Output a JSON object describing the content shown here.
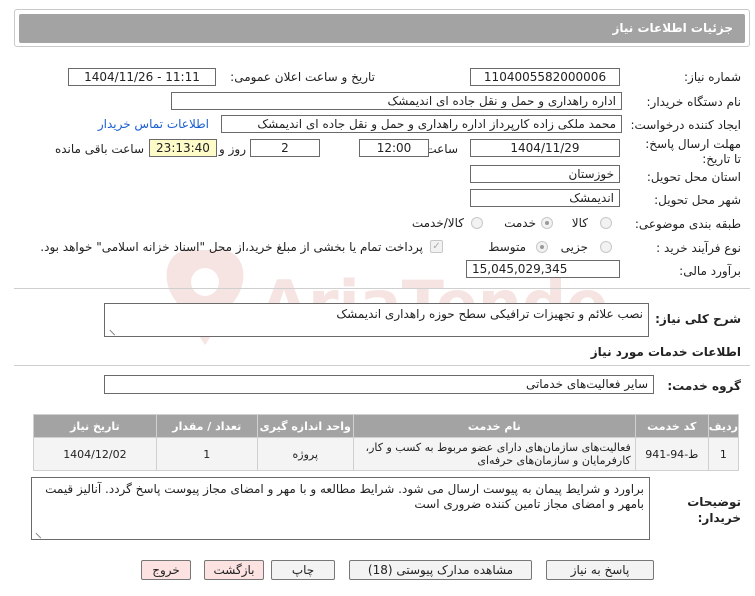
{
  "page": {
    "title": "جزئیات اطلاعات نیاز"
  },
  "form": {
    "need_number_label": "شماره نیاز:",
    "need_number": "1104005582000006",
    "announce_label": "تاریخ و ساعت اعلان عمومی:",
    "announce_value": "1404/11/26 - 11:11",
    "buyer_org_label": "نام دستگاه خریدار:",
    "buyer_org": "اداره راهداری و حمل و نقل جاده ای اندیمشک",
    "creator_label": "ایجاد کننده درخواست:",
    "creator": "محمد ملکی زاده کارپرداز اداره راهداری و حمل و نقل جاده ای اندیمشک",
    "contact_link": "اطلاعات تماس خریدار",
    "deadline_label": "مهلت ارسال پاسخ: تا تاریخ:",
    "deadline_date": "1404/11/29",
    "time_label": "ساعت",
    "deadline_time": "12:00",
    "days_value": "2",
    "days_label": "روز و",
    "remaining_time": "23:13:40",
    "remaining_label": "ساعت باقی مانده",
    "province_label": "استان محل تحویل:",
    "province": "خوزستان",
    "city_label": "شهر محل تحویل:",
    "city": "اندیمشک",
    "category_label": "طبقه بندی موضوعی:",
    "category_options": [
      "کالا",
      "خدمت",
      "کالا/خدمت"
    ],
    "category_selected": "خدمت",
    "purchase_type_label": "نوع فرآیند خرید :",
    "purchase_options": [
      "جزیی",
      "متوسط"
    ],
    "purchase_selected": "متوسط",
    "payment_note": "پرداخت تمام یا بخشی از مبلغ خرید،از محل \"اسناد خزانه اسلامی\" خواهد بود.",
    "estimate_label": "برآورد مالی:",
    "estimate": "15,045,029,345"
  },
  "summary": {
    "label": "شرح کلی نیاز:",
    "text": "نصب علائم و تجهیزات ترافیکی سطح حوزه راهداری اندیمشک"
  },
  "services": {
    "section_title": "اطلاعات خدمات مورد نیاز",
    "group_label": "گروه خدمت:",
    "group_value": "سایر فعالیت‌های خدماتی",
    "table": {
      "headers": [
        "ردیف",
        "کد خدمت",
        "نام خدمت",
        "واحد اندازه گیری",
        "تعداد / مقدار",
        "تاریخ نیاز"
      ],
      "rows": [
        [
          "1",
          "ط-94-941",
          "فعالیت‌های سازمان‌های دارای عضو مربوط به کسب و کار، کارفرمایان و سازمان‌های حرفه‌ای",
          "پروژه",
          "1",
          "1404/12/02"
        ]
      ]
    }
  },
  "buyer_notes": {
    "label": "توضیحات خریدار:",
    "text": "براورد و شرایط پیمان به پیوست ارسال می شود. شرایط مطالعه و با مهر و امضای مجاز پیوست پاسخ گردد. آنالیز قیمت بامهر و امضای مجاز تامین کننده ضروری است"
  },
  "buttons": {
    "reply": "پاسخ به نیاز",
    "attachments": "مشاهده مدارک پیوستی (18)",
    "print": "چاپ",
    "back": "بازگشت",
    "exit": "خروج"
  },
  "watermark": "AriaTender.neT",
  "colors": {
    "header_bg": "#a3a3a3",
    "link": "#1a5fd0",
    "highlight": "#fdfbc8"
  }
}
